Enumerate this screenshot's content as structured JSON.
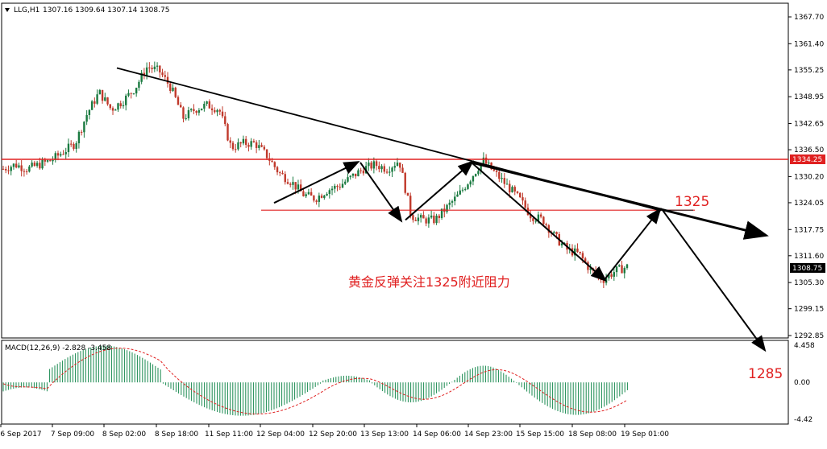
{
  "header": {
    "symbol": "LLG,H1",
    "ohlc": "1307.16 1309.64 1307.14 1308.75"
  },
  "macd": {
    "label": "MACD(12,26,9) -2.828 -3.458"
  },
  "annotations": {
    "level_1325": "1325",
    "level_1285": "1285",
    "comment": "黄金反弹关注1325附近阻力"
  },
  "chart_data": [
    {
      "type": "candlestick",
      "symbol": "LLG",
      "timeframe": "H1",
      "y_ticks": [
        1367.7,
        1361.4,
        1355.25,
        1348.95,
        1342.65,
        1336.5,
        1330.2,
        1324.05,
        1317.75,
        1311.6,
        1305.3,
        1299.15,
        1292.85
      ],
      "y_tick_labels": [
        "1367.70",
        "1361.40",
        "1355.25",
        "1348.95",
        "1342.65",
        "1336.50",
        "1330.20",
        "1324.05",
        "1317.75",
        "1311.60",
        "1305.30",
        "1299.15",
        "1292.85"
      ],
      "x_tick_labels": [
        "6 Sep 2017",
        "7 Sep 09:00",
        "8 Sep 02:00",
        "8 Sep 18:00",
        "11 Sep 11:00",
        "12 Sep 04:00",
        "12 Sep 20:00",
        "13 Sep 13:00",
        "14 Sep 06:00",
        "14 Sep 23:00",
        "15 Sep 15:00",
        "18 Sep 08:00",
        "19 Sep 01:00"
      ],
      "current_price": 1308.75,
      "current_price_label": "1308.75",
      "resistance_level": 1334.25,
      "resistance_label": "1334.25",
      "support_level": 1322.3,
      "trendline": {
        "from_price": 1355.7,
        "to_price": 1322.2
      },
      "bull_color": "#1a7a40",
      "bear_color": "#c0392b",
      "level_color": "#e02020",
      "candle_path": [
        1332,
        1333,
        1332,
        1333,
        1334,
        1336,
        1338,
        1345,
        1350,
        1346,
        1348,
        1351,
        1356,
        1355,
        1351,
        1344,
        1346,
        1347,
        1346,
        1337,
        1338,
        1338,
        1335,
        1331,
        1329,
        1326,
        1325,
        1327,
        1328,
        1330,
        1332,
        1333,
        1332,
        1334,
        1321,
        1320,
        1320,
        1323,
        1326,
        1330,
        1334,
        1331,
        1328,
        1325,
        1321,
        1320,
        1316,
        1313,
        1312,
        1308,
        1306,
        1308,
        1309
      ]
    },
    {
      "type": "bar",
      "name": "MACD(12,26,9)",
      "y_tick_labels": [
        "4.458",
        "0.00",
        "-4.42"
      ],
      "y_ticks": [
        4.458,
        0,
        -4.42
      ],
      "histogram_color": "#1a8a50",
      "signal_color": "#e02020",
      "value": -2.828,
      "signal": -3.458
    }
  ]
}
